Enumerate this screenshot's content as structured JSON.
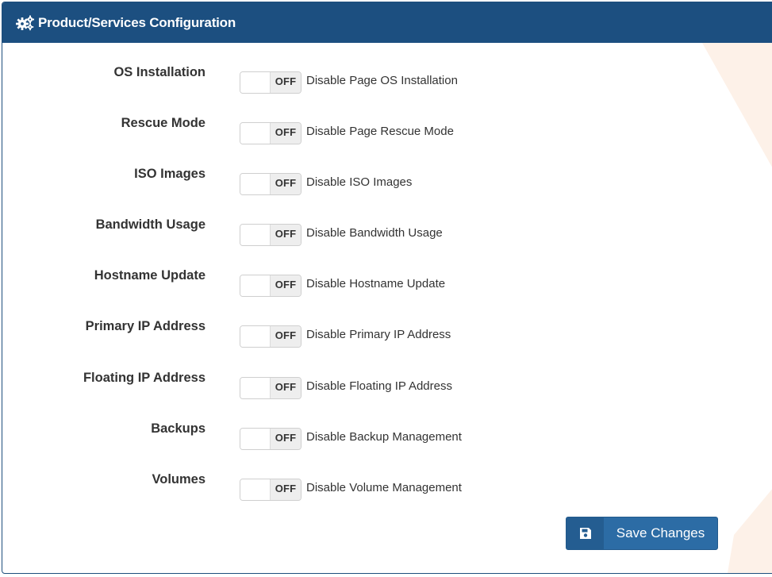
{
  "header": {
    "title": "Product/Services Configuration",
    "icon": "gears-icon"
  },
  "colors": {
    "header_bg": "#1c4f80",
    "button_bg": "#2c6ca5",
    "switch_off_bg": "#eeeeee"
  },
  "settings": [
    {
      "label": "OS Installation",
      "state": "OFF",
      "description": "Disable Page OS Installation"
    },
    {
      "label": "Rescue Mode",
      "state": "OFF",
      "description": "Disable Page Rescue Mode"
    },
    {
      "label": "ISO Images",
      "state": "OFF",
      "description": "Disable ISO Images"
    },
    {
      "label": "Bandwidth Usage",
      "state": "OFF",
      "description": "Disable Bandwidth Usage"
    },
    {
      "label": "Hostname Update",
      "state": "OFF",
      "description": "Disable Hostname Update"
    },
    {
      "label": "Primary IP Address",
      "state": "OFF",
      "description": "Disable Primary IP Address"
    },
    {
      "label": "Floating IP Address",
      "state": "OFF",
      "description": "Disable Floating IP Address"
    },
    {
      "label": "Backups",
      "state": "OFF",
      "description": "Disable Backup Management"
    },
    {
      "label": "Volumes",
      "state": "OFF",
      "description": "Disable Volume Management"
    }
  ],
  "footer": {
    "save_label": "Save Changes",
    "save_icon": "floppy-disk-icon"
  }
}
